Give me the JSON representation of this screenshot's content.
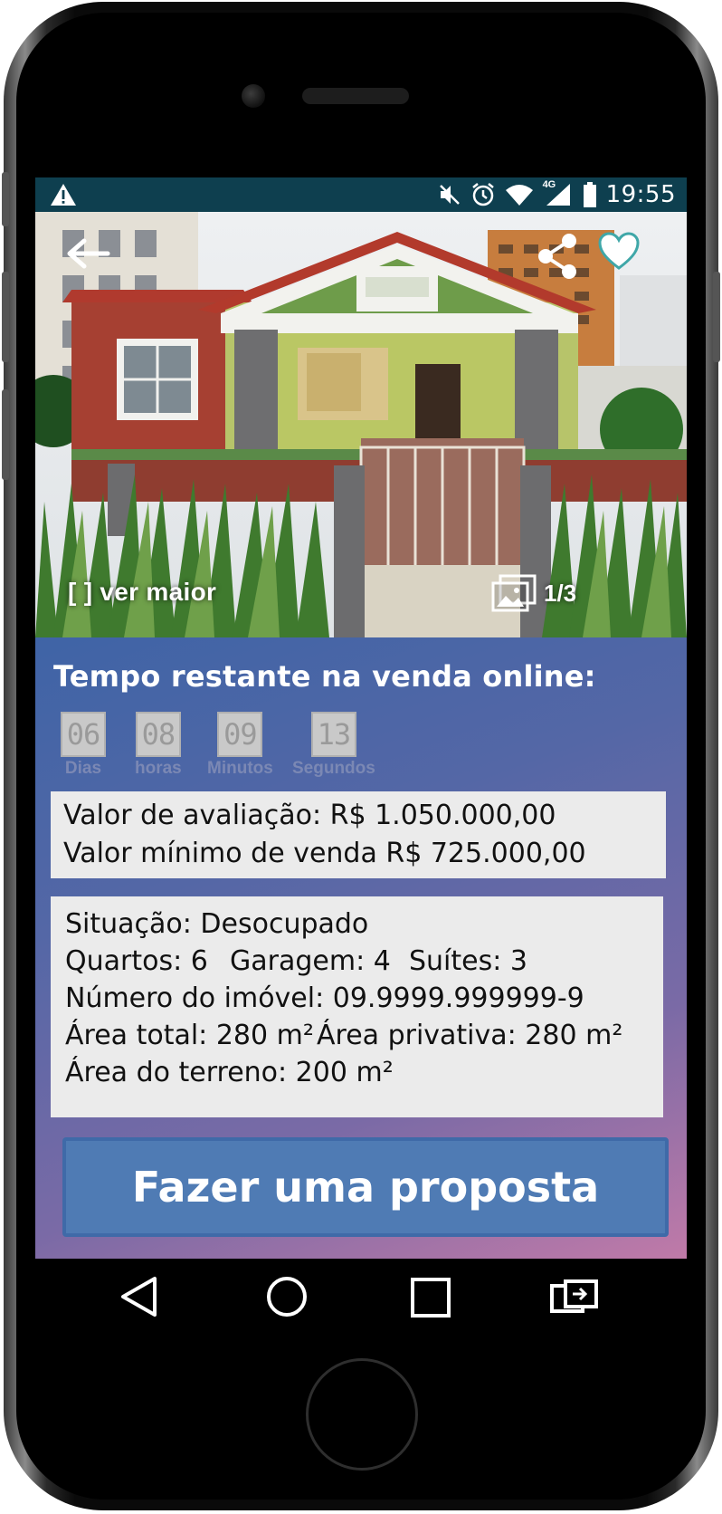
{
  "status_bar": {
    "time": "19:55",
    "network_badge": "4G",
    "icons": [
      "warning-icon",
      "mute-icon",
      "alarm-icon",
      "wifi-icon",
      "signal-icon",
      "battery-icon"
    ]
  },
  "hero": {
    "ver_maior_label": "[ ] ver maior",
    "gallery_counter": "1/3",
    "icons": [
      "back-arrow-icon",
      "share-icon",
      "heart-icon",
      "gallery-icon"
    ]
  },
  "timer": {
    "title": "Tempo restante na venda online:",
    "units": [
      {
        "value": "06",
        "label": "Dias"
      },
      {
        "value": "08",
        "label": "horas"
      },
      {
        "value": "09",
        "label": "Minutos"
      },
      {
        "value": "13",
        "label": "Segundos"
      }
    ]
  },
  "values": {
    "avaliacao": "Valor de avaliação: R$ 1.050.000,00",
    "minimo": "Valor mínimo de venda R$ 725.000,00"
  },
  "details": {
    "situacao": "Situação: Desocupado",
    "quartos": "Quartos: 6",
    "garagem": "Garagem: 4",
    "suites": "Suítes: 3",
    "numero": "Número do imóvel: 09.9999.999999-9",
    "area_total": "Área total: 280 m²",
    "area_privativa": "Área privativa: 280 m²",
    "area_terreno": "Área do terreno: 200 m²"
  },
  "cta": {
    "label": "Fazer uma proposta"
  },
  "nav": [
    "back-triangle-icon",
    "home-circle-icon",
    "recents-square-icon",
    "switch-icon"
  ],
  "colors": {
    "status_bar": "#0e3f4f",
    "cta": "#4f7bb4",
    "panel_top": "#3f64a6",
    "panel_bottom": "#c07aa8"
  }
}
